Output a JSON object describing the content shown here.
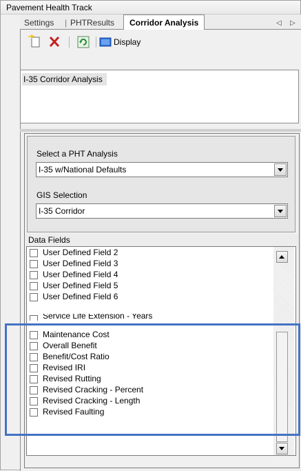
{
  "panel": {
    "title": "Pavement Health Track"
  },
  "tabs": [
    {
      "label": "Settings"
    },
    {
      "label": "PHTResults"
    },
    {
      "label": "Corridor Analysis"
    }
  ],
  "tab_separator": "|",
  "tab_scroll": {
    "left": "◁",
    "right": "▷"
  },
  "toolbar": {
    "new_icon": "new-document-icon",
    "delete_icon": "delete-x-icon",
    "refresh_icon": "refresh-icon",
    "display_label": "Display"
  },
  "analysis_list": {
    "items": [
      "I-35 Corridor Analysis"
    ]
  },
  "pht_analysis": {
    "label": "Select a PHT Analysis",
    "value": "I-35 w/National Defaults"
  },
  "gis_selection": {
    "label": "GIS Selection",
    "value": "I-35 Corridor"
  },
  "data_fields": {
    "label": "Data Fields",
    "items": [
      {
        "label": "User Defined Field 2",
        "checked": false
      },
      {
        "label": "User Defined Field 3",
        "checked": false
      },
      {
        "label": "User Defined Field 4",
        "checked": false
      },
      {
        "label": "User Defined Field 5",
        "checked": false
      },
      {
        "label": "User Defined Field 6",
        "checked": false
      },
      {
        "label": "Service Life Extension - Years",
        "checked": false
      },
      {
        "label": "Maintenance Cost",
        "checked": false
      },
      {
        "label": "Overall Benefit",
        "checked": false
      },
      {
        "label": "Benefit/Cost Ratio",
        "checked": false
      },
      {
        "label": "Revised IRI",
        "checked": false
      },
      {
        "label": "Revised Rutting",
        "checked": false
      },
      {
        "label": "Revised Cracking - Percent",
        "checked": false
      },
      {
        "label": "Revised Cracking - Length",
        "checked": false
      },
      {
        "label": "Revised Faulting",
        "checked": false
      }
    ]
  },
  "colors": {
    "highlight": "#4472c4",
    "delete": "#c62020",
    "refresh": "#1e8c2e",
    "display": "#2e6fd8"
  }
}
